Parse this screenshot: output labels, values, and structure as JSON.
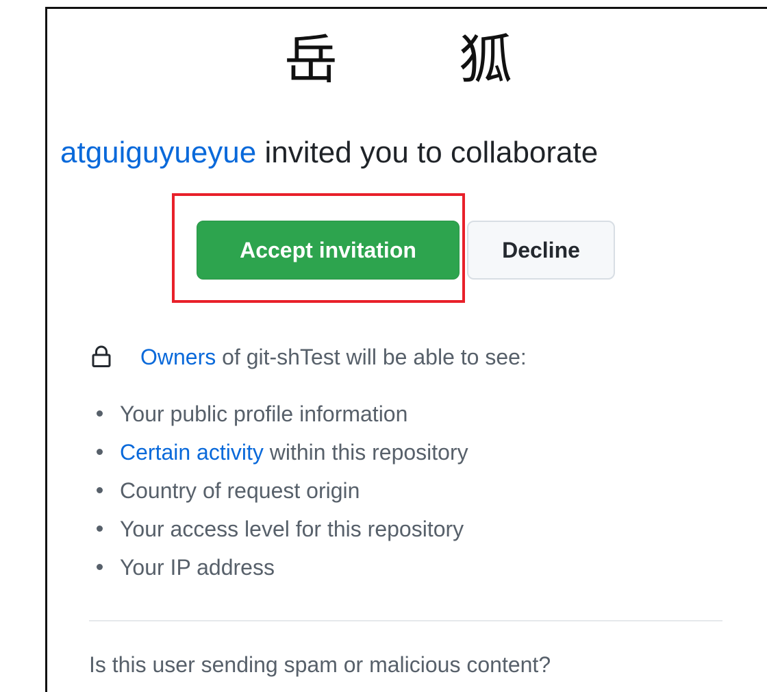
{
  "avatar": {
    "char1": "岳",
    "char2": "狐"
  },
  "invite": {
    "inviter": "atguiguyueyue",
    "message": " invited you to collaborate"
  },
  "actions": {
    "accept_label": "Accept invitation",
    "decline_label": "Decline"
  },
  "owners": {
    "link": "Owners",
    "text": " of git-shTest will be able to see:"
  },
  "permissions": [
    {
      "link": "",
      "text": "Your public profile information"
    },
    {
      "link": "Certain activity",
      "text": " within this repository"
    },
    {
      "link": "",
      "text": "Country of request origin"
    },
    {
      "link": "",
      "text": "Your access level for this repository"
    },
    {
      "link": "",
      "text": "Your IP address"
    }
  ],
  "spam_question": "Is this user sending spam or malicious content?",
  "colors": {
    "accent_link": "#0969da",
    "accept_green": "#2da44e",
    "highlight_red": "#e8202a"
  },
  "icons": {
    "lock": "lock-icon"
  }
}
